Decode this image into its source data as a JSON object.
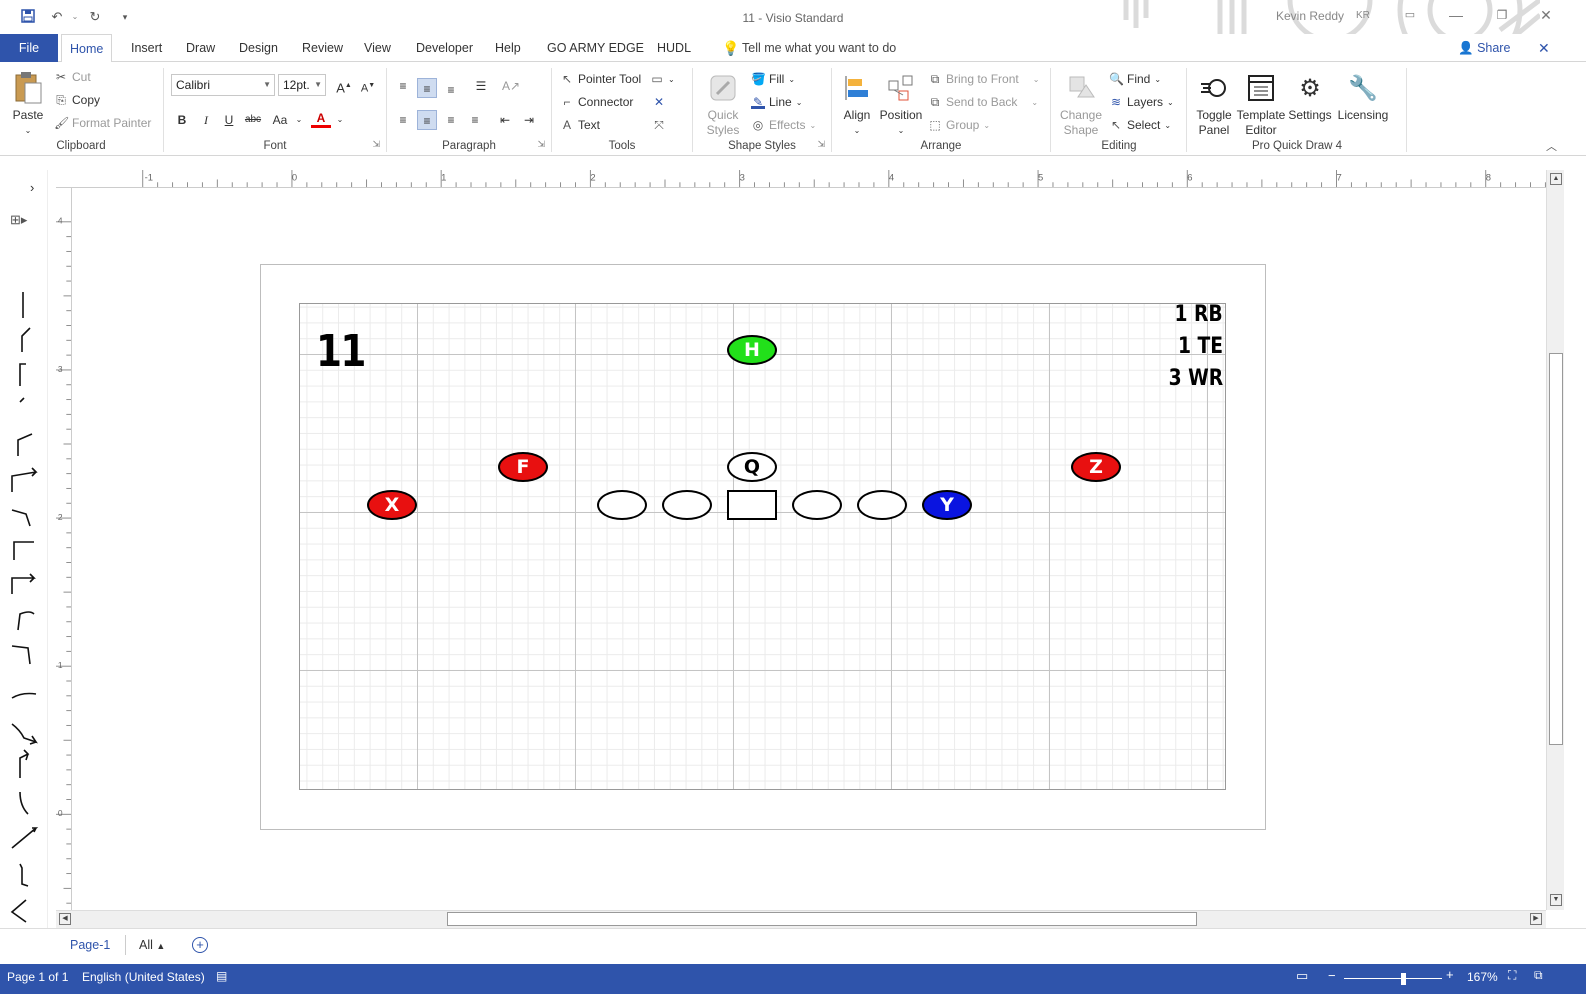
{
  "window": {
    "title": "11  -  Visio Standard",
    "user_name": "Kevin Reddy",
    "user_initials": "KR",
    "share_label": "Share"
  },
  "quick_access": {
    "save": "save-icon",
    "undo": "undo-icon",
    "redo": "redo-icon",
    "customize": "customize-icon"
  },
  "menu_tabs": [
    "File",
    "Home",
    "Insert",
    "Draw",
    "Design",
    "Review",
    "View",
    "Developer",
    "Help",
    "GO ARMY EDGE",
    "HUDL"
  ],
  "active_tab": "Home",
  "tell_me": "Tell me what you want to do",
  "ribbon": {
    "clipboard": {
      "label": "Clipboard",
      "paste": "Paste",
      "cut": "Cut",
      "copy": "Copy",
      "format_painter": "Format Painter"
    },
    "font": {
      "label": "Font",
      "family": "Calibri",
      "size": "12pt.",
      "bold": "B",
      "italic": "I",
      "underline": "U",
      "strike": "abc",
      "case": "Aa",
      "color": "A"
    },
    "paragraph": {
      "label": "Paragraph"
    },
    "tools": {
      "label": "Tools",
      "pointer": "Pointer Tool",
      "connector": "Connector",
      "text": "Text"
    },
    "shape_styles": {
      "label": "Shape Styles",
      "quick_styles_1": "Quick",
      "quick_styles_2": "Styles",
      "fill": "Fill",
      "line": "Line",
      "effects": "Effects"
    },
    "arrange": {
      "label": "Arrange",
      "align": "Align",
      "position": "Position",
      "bring_front": "Bring to Front",
      "send_back": "Send to Back",
      "group": "Group"
    },
    "editing": {
      "label": "Editing",
      "change_shape_1": "Change",
      "change_shape_2": "Shape",
      "find": "Find",
      "layers": "Layers",
      "select": "Select"
    },
    "pro_quick_draw": {
      "label": "Pro Quick Draw 4",
      "toggle_1": "Toggle",
      "toggle_2": "Panel",
      "template_1": "Template",
      "template_2": "Editor",
      "settings": "Settings",
      "licensing": "Licensing"
    }
  },
  "ruler": {
    "h_labels": [
      "-1",
      "0",
      "1",
      "2",
      "3",
      "4",
      "5",
      "6",
      "7",
      "8"
    ],
    "v_labels": [
      "4",
      "3",
      "2",
      "1",
      "0"
    ]
  },
  "diagram": {
    "formation_number": "11",
    "personnel": [
      "1 RB",
      "1 TE",
      "3 WR"
    ],
    "players": {
      "H": {
        "label": "H",
        "color": "#22e01a"
      },
      "F": {
        "label": "F",
        "color": "#e81010"
      },
      "Q": {
        "label": "Q",
        "color": "#ffffff"
      },
      "Z": {
        "label": "Z",
        "color": "#e81010"
      },
      "X": {
        "label": "X",
        "color": "#e81010"
      },
      "Y": {
        "label": "Y",
        "color": "#0a14e0"
      }
    }
  },
  "page_tabs": {
    "page": "Page-1",
    "all": "All"
  },
  "status": {
    "page_info": "Page 1 of 1",
    "language": "English (United States)",
    "zoom": "167%"
  },
  "colors": {
    "accent": "#2f54ab"
  }
}
